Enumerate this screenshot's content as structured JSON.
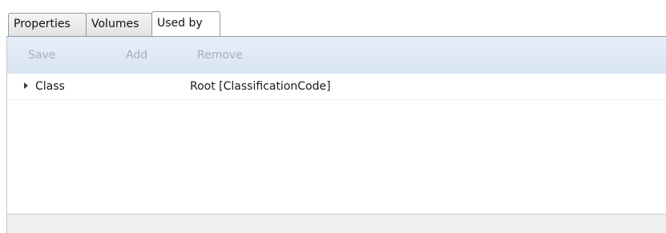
{
  "tabs": [
    {
      "label": "Properties",
      "active": false
    },
    {
      "label": "Volumes",
      "active": false
    },
    {
      "label": "Used by",
      "active": true
    }
  ],
  "toolbar": {
    "save_label": "Save",
    "add_label": "Add",
    "remove_label": "Remove",
    "buttons_enabled": false
  },
  "tree": {
    "rows": [
      {
        "expander": "collapsed",
        "name": "Class",
        "value": "Root [ClassificationCode]"
      }
    ]
  },
  "colors": {
    "toolbar_background": "#dfe9f5",
    "disabled_text": "#a6b0bb",
    "footer_background": "#f0f0f0"
  }
}
